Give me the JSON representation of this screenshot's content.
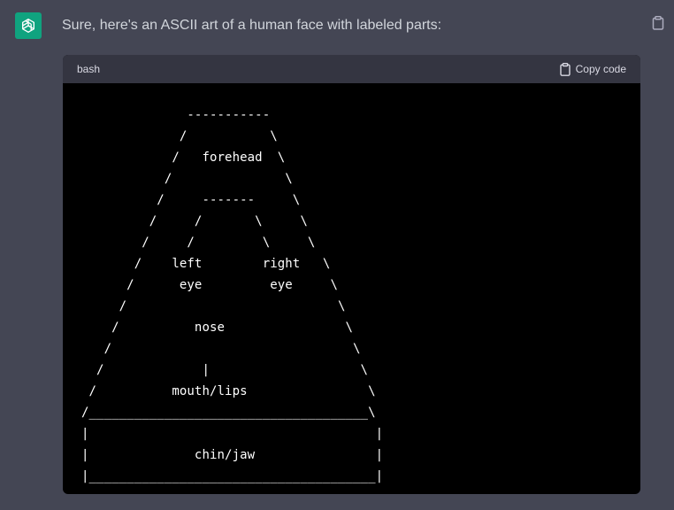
{
  "message": {
    "text": "Sure, here's an ASCII art of a human face with labeled parts:"
  },
  "icons": {
    "avatar": "openai-logo-icon",
    "copy_message": "clipboard-icon",
    "copy_code": "clipboard-icon"
  },
  "colors": {
    "background": "#444654",
    "avatar": "#10a37f",
    "code_header": "#343541",
    "code_body": "#000000",
    "text": "#d1d5db"
  },
  "code_block": {
    "language": "bash",
    "copy_label": "Copy code",
    "content": "              -----------\n             /           \\\n            /   forehead  \\\n           /               \\\n          /     -------     \\\n         /     /       \\     \\\n        /     /         \\     \\\n       /    left        right   \\\n      /      eye         eye     \\\n     /                            \\\n    /          nose                \\\n   /                                \\\n  /             |                    \\\n /          mouth/lips                \\\n/_____________________________________\\\n|                                      |\n|              chin/jaw                |\n|______________________________________|"
  }
}
